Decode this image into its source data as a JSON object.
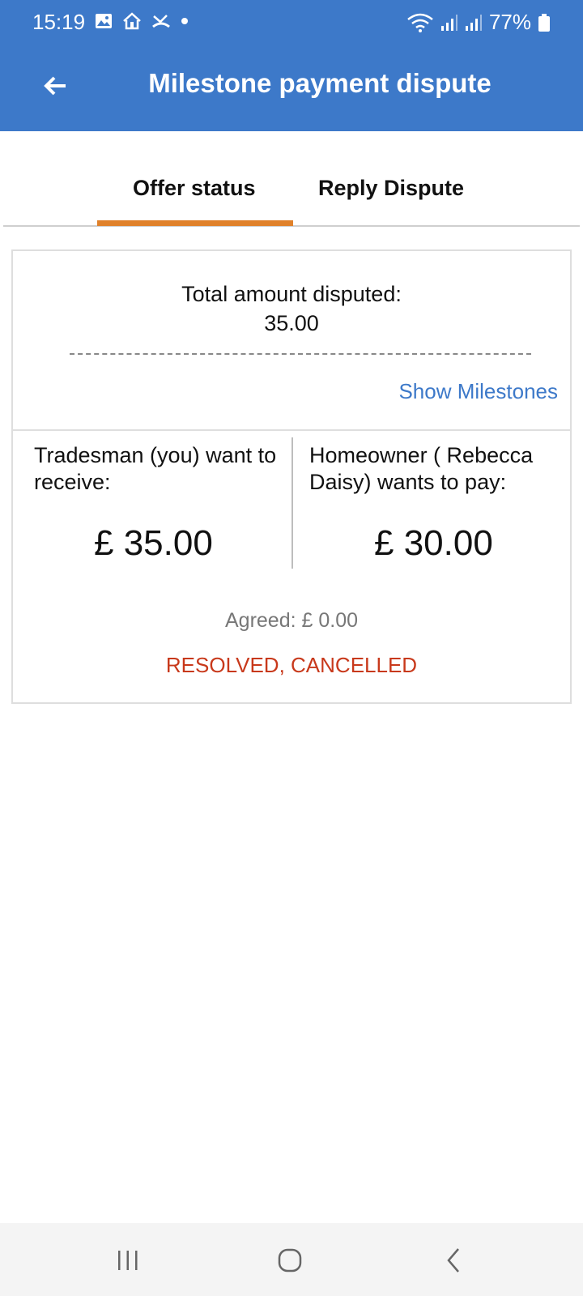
{
  "status_bar": {
    "time": "15:19",
    "battery": "77%"
  },
  "app_bar": {
    "title": "Milestone payment dispute"
  },
  "tabs": [
    {
      "label": "Offer status",
      "active": true
    },
    {
      "label": "Reply Dispute",
      "active": false
    }
  ],
  "card": {
    "total_label": "Total amount disputed:",
    "total_value": "35.00",
    "show_milestones": "Show Milestones",
    "tradesman": {
      "label": "Tradesman (you) want to receive:",
      "amount": "£ 35.00"
    },
    "homeowner": {
      "label": "Homeowner ( Rebecca Daisy) wants to pay:",
      "amount": "£ 30.00"
    },
    "agreed": "Agreed: £ 0.00",
    "status": "RESOLVED, CANCELLED"
  },
  "colors": {
    "primary": "#3d79c9",
    "tab_indicator": "#e0812a",
    "status_red": "#c8391b"
  }
}
